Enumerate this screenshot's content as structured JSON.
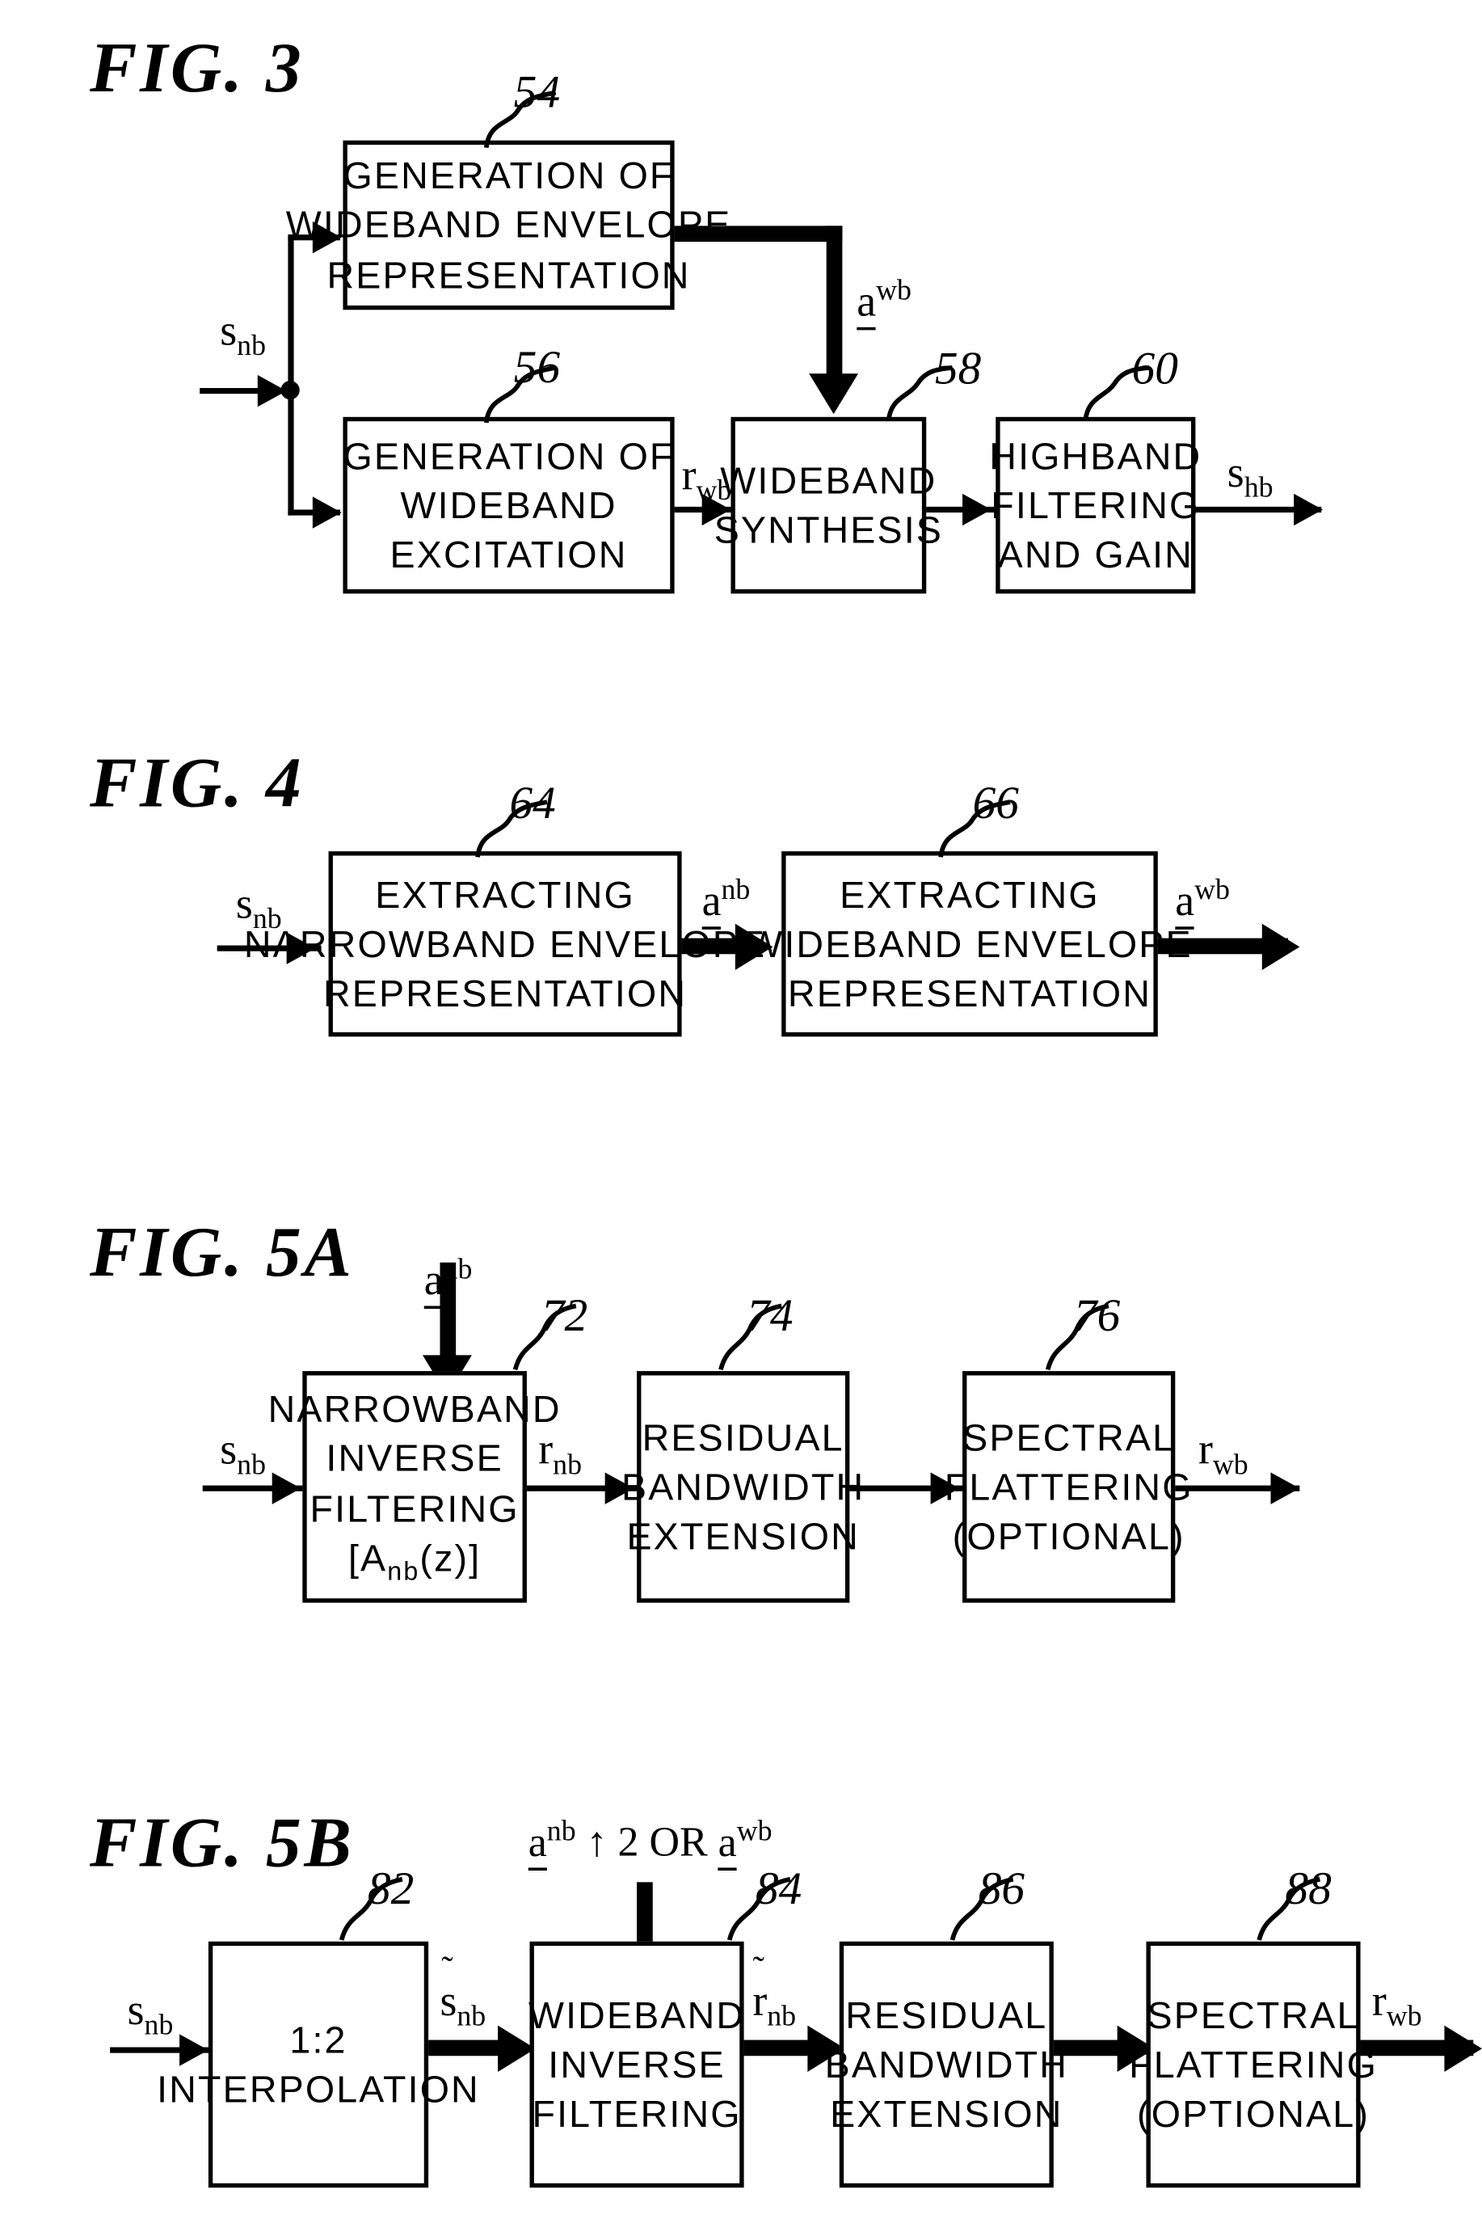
{
  "figures": [
    {
      "id": "fig3",
      "title": "FIG.  3",
      "boxes": [
        {
          "ref": "54",
          "lines": [
            "GENERATION OF",
            "WIDEBAND ENVELOPE",
            "REPRESENTATION"
          ]
        },
        {
          "ref": "56",
          "lines": [
            "GENERATION OF",
            "WIDEBAND",
            "EXCITATION"
          ]
        },
        {
          "ref": "58",
          "lines": [
            "WIDEBAND",
            "SYNTHESIS"
          ]
        },
        {
          "ref": "60",
          "lines": [
            "HIGHBAND",
            "FILTERING",
            "AND GAIN"
          ]
        }
      ],
      "signals": {
        "input": "s_nb",
        "envelope_out": "a_wb",
        "excitation_out": "r_wb",
        "output": "s_hb"
      }
    },
    {
      "id": "fig4",
      "title": "FIG.  4",
      "boxes": [
        {
          "ref": "64",
          "lines": [
            "EXTRACTING",
            "NARROWBAND ENVELOPE",
            "REPRESENTATION"
          ]
        },
        {
          "ref": "66",
          "lines": [
            "EXTRACTING",
            "WIDEBAND ENVELOPE",
            "REPRESENTATION"
          ]
        }
      ],
      "signals": {
        "input": "s_nb",
        "mid": "a_nb",
        "output": "a_wb"
      }
    },
    {
      "id": "fig5a",
      "title": "FIG.  5A",
      "boxes": [
        {
          "ref": "72",
          "lines": [
            "NARROWBAND",
            "INVERSE",
            "FILTERING",
            "[A_nb(z)]"
          ]
        },
        {
          "ref": "74",
          "lines": [
            "RESIDUAL",
            "BANDWIDTH",
            "EXTENSION"
          ]
        },
        {
          "ref": "76",
          "lines": [
            "SPECTRAL",
            "FLATTERING",
            "(OPTIONAL)"
          ]
        }
      ],
      "signals": {
        "input": "s_nb",
        "top_input": "a_nb",
        "mid1": "r_nb",
        "output": "r_wb"
      }
    },
    {
      "id": "fig5b",
      "title": "FIG.  5B",
      "boxes": [
        {
          "ref": "82",
          "lines": [
            "1:2",
            "INTERPOLATION"
          ]
        },
        {
          "ref": "84",
          "lines": [
            "WIDEBAND",
            "INVERSE",
            "FILTERING"
          ]
        },
        {
          "ref": "86",
          "lines": [
            "RESIDUAL",
            "BANDWIDTH",
            "EXTENSION"
          ]
        },
        {
          "ref": "88",
          "lines": [
            "SPECTRAL",
            "FLATTERING",
            "(OPTIONAL)"
          ]
        }
      ],
      "signals": {
        "input": "s_nb",
        "top_input": "a_nb_up2_or_a_wb",
        "top_input_parts": {
          "first": "a",
          "first_sup": "nb",
          "arrow": "2",
          "or": "OR",
          "second": "a",
          "second_sup": "wb"
        },
        "mid1": "s_nb_tilde",
        "mid2": "r_nb_tilde",
        "output": "r_wb"
      }
    }
  ],
  "labels": {
    "s_nb": {
      "base": "s",
      "sub": "nb"
    },
    "s_hb": {
      "base": "s",
      "sub": "hb"
    },
    "r_nb": {
      "base": "r",
      "sub": "nb"
    },
    "r_wb": {
      "base": "r",
      "sub": "wb"
    },
    "a_nb": {
      "base": "a",
      "sup": "nb"
    },
    "a_wb": {
      "base": "a",
      "sup": "wb"
    },
    "one_two": "1:2",
    "or_text": "OR",
    "two": "2"
  },
  "colors": {
    "ink": "#000000",
    "paper": "#ffffff"
  }
}
